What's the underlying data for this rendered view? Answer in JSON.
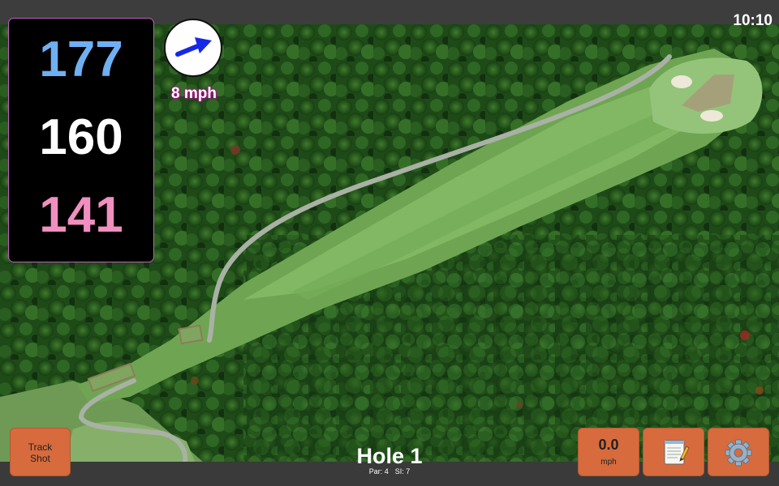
{
  "status_bar": {
    "time": "10:10"
  },
  "distances": {
    "back": "177",
    "center": "160",
    "front": "141"
  },
  "wind": {
    "speed_label": "8 mph",
    "direction_icon": "arrow-icon"
  },
  "track_shot": {
    "label_line1": "Track",
    "label_line2": "Shot"
  },
  "hole": {
    "title": "Hole 1",
    "par_label": "Par: 4",
    "si_label": "SI: 7"
  },
  "speed_button": {
    "value": "0.0",
    "unit": "mph"
  },
  "notes_button": {
    "icon": "notepad-icon"
  },
  "settings_button": {
    "icon": "gear-icon"
  },
  "colors": {
    "back_distance": "#6fb0f2",
    "center_distance": "#ffffff",
    "front_distance": "#f08fc0",
    "button_orange": "#d76b3d",
    "wind_arrow": "#1428e6"
  }
}
